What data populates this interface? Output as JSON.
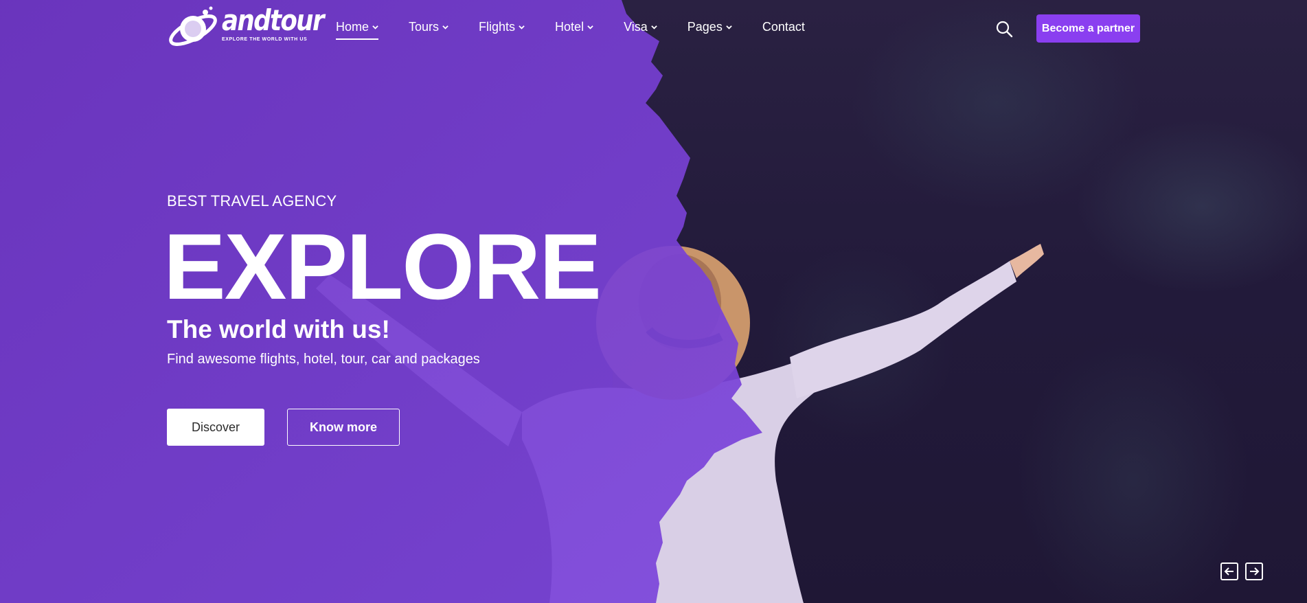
{
  "brand": {
    "name": "andtour",
    "tagline": "EXPLORE THE WORLD WITH US"
  },
  "nav": {
    "items": [
      {
        "label": "Home",
        "has_dropdown": true,
        "active": true
      },
      {
        "label": "Tours",
        "has_dropdown": true
      },
      {
        "label": "Flights",
        "has_dropdown": true
      },
      {
        "label": "Hotel",
        "has_dropdown": true
      },
      {
        "label": "Visa",
        "has_dropdown": true
      },
      {
        "label": "Pages",
        "has_dropdown": true
      },
      {
        "label": "Contact",
        "has_dropdown": false
      }
    ]
  },
  "header": {
    "search_icon": "search-icon",
    "partner_label": "Become a partner"
  },
  "hero": {
    "eyebrow": "BEST TRAVEL AGENCY",
    "headline": "EXPLORE",
    "subheadline": "The world with us!",
    "description": "Find awesome flights, hotel, tour, car and packages",
    "primary_button": "Discover",
    "secondary_button": "Know more"
  },
  "slider": {
    "prev_icon": "arrow-left-icon",
    "next_icon": "arrow-right-icon"
  },
  "colors": {
    "purple_overlay": "#7a45d4",
    "partner_button": "#8a3ff0",
    "dark_background": "#24193f"
  }
}
